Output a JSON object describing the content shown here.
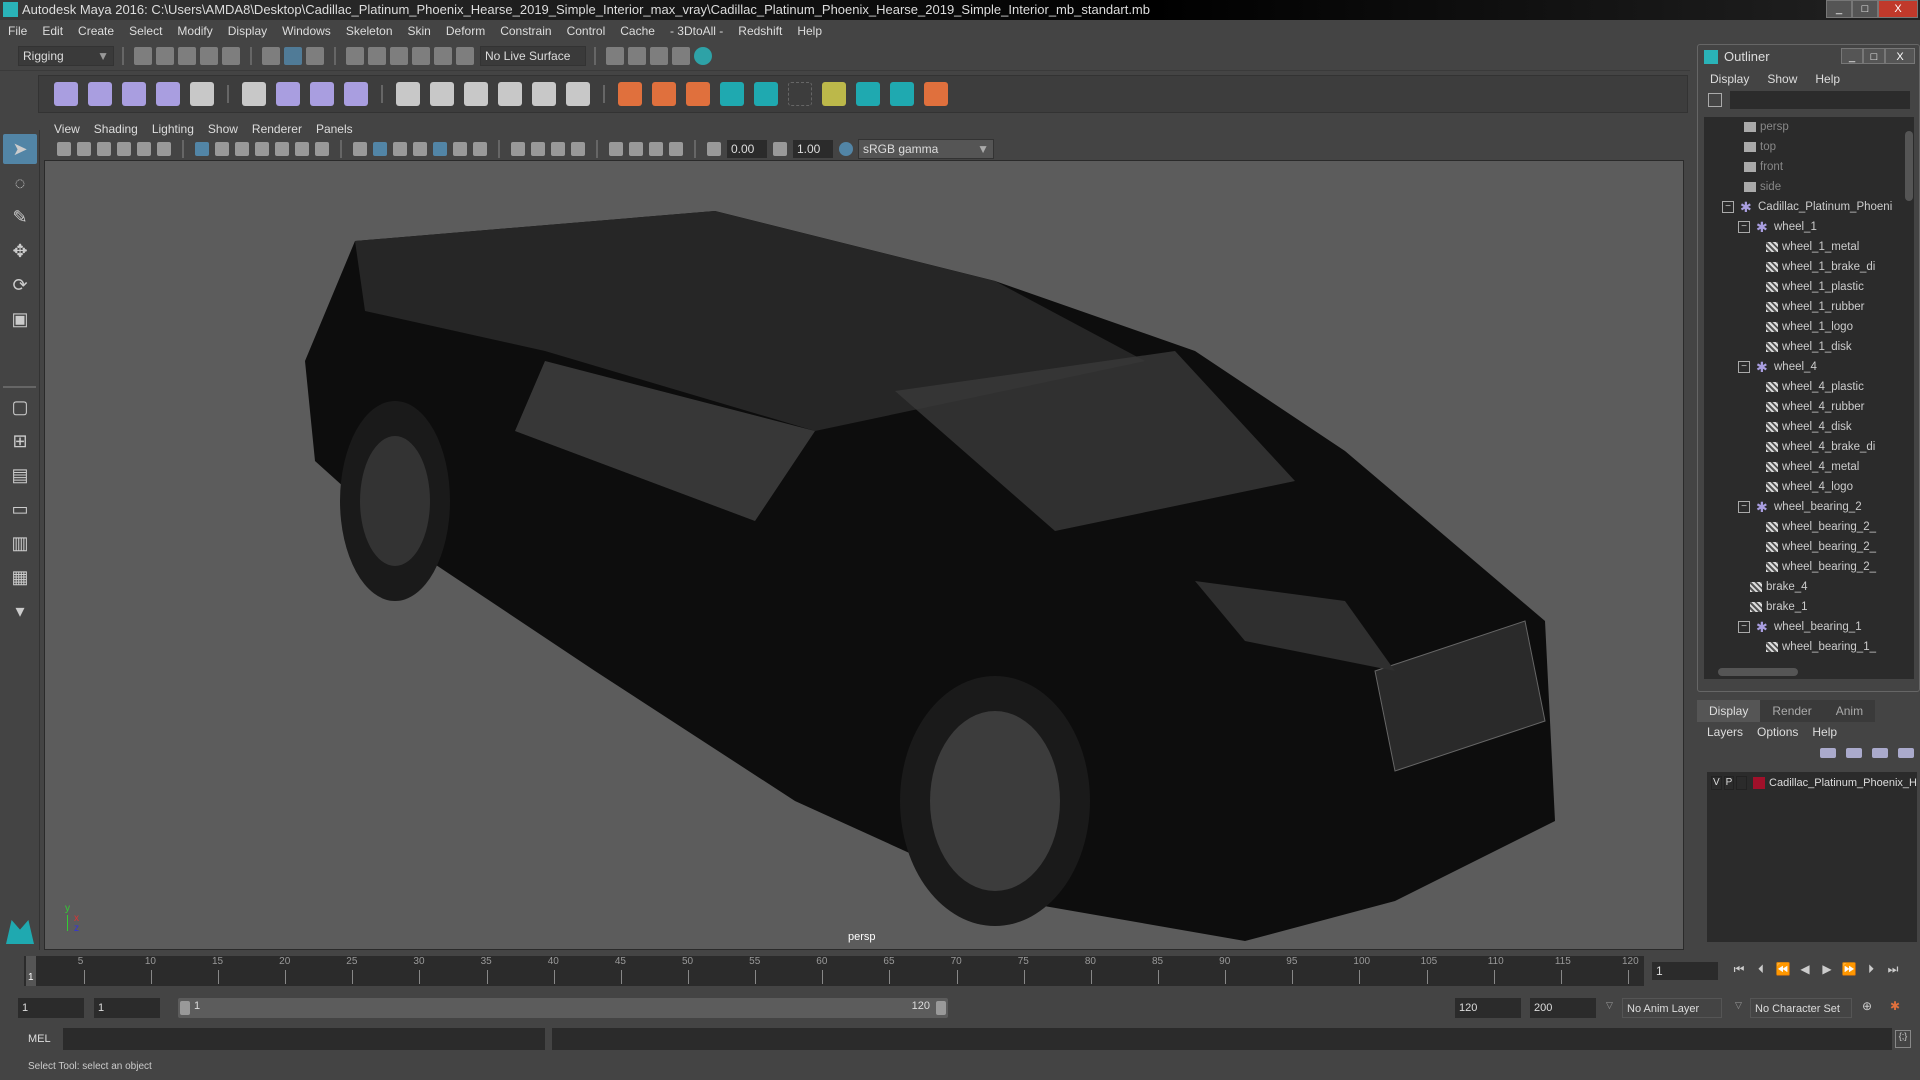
{
  "window": {
    "title": "Autodesk Maya 2016: C:\\Users\\AMDA8\\Desktop\\Cadillac_Platinum_Phoenix_Hearse_2019_Simple_Interior_max_vray\\Cadillac_Platinum_Phoenix_Hearse_2019_Simple_Interior_mb_standart.mb",
    "minimize": "_",
    "maximize": "□",
    "close": "X"
  },
  "menubar": [
    "File",
    "Edit",
    "Create",
    "Select",
    "Modify",
    "Display",
    "Windows",
    "Skeleton",
    "Skin",
    "Deform",
    "Constrain",
    "Control",
    "Cache",
    "- 3DtoAll -",
    "Redshift",
    "Help"
  ],
  "statusline": {
    "mode": "Rigging",
    "live_surface": "No Live Surface"
  },
  "panel": {
    "menu": [
      "View",
      "Shading",
      "Lighting",
      "Show",
      "Renderer",
      "Panels"
    ],
    "exposure": "0.00",
    "gamma": "1.00",
    "color_space": "sRGB gamma",
    "camera_label": "persp",
    "axis": {
      "x": "x",
      "y": "y",
      "z": "z"
    }
  },
  "outliner": {
    "title": "Outliner",
    "menu": [
      "Display",
      "Show",
      "Help"
    ],
    "items": [
      {
        "label": "persp",
        "type": "camera",
        "depth": 0
      },
      {
        "label": "top",
        "type": "camera",
        "depth": 0
      },
      {
        "label": "front",
        "type": "camera",
        "depth": 0
      },
      {
        "label": "side",
        "type": "camera",
        "depth": 0
      },
      {
        "label": "Cadillac_Platinum_Phoeni",
        "type": "group",
        "depth": 0,
        "expanded": true
      },
      {
        "label": "wheel_1",
        "type": "group",
        "depth": 1,
        "expanded": true
      },
      {
        "label": "wheel_1_metal",
        "type": "mesh",
        "depth": 2
      },
      {
        "label": "wheel_1_brake_di",
        "type": "mesh",
        "depth": 2
      },
      {
        "label": "wheel_1_plastic",
        "type": "mesh",
        "depth": 2
      },
      {
        "label": "wheel_1_rubber",
        "type": "mesh",
        "depth": 2
      },
      {
        "label": "wheel_1_logo",
        "type": "mesh",
        "depth": 2
      },
      {
        "label": "wheel_1_disk",
        "type": "mesh",
        "depth": 2
      },
      {
        "label": "wheel_4",
        "type": "group",
        "depth": 1,
        "expanded": true
      },
      {
        "label": "wheel_4_plastic",
        "type": "mesh",
        "depth": 2
      },
      {
        "label": "wheel_4_rubber",
        "type": "mesh",
        "depth": 2
      },
      {
        "label": "wheel_4_disk",
        "type": "mesh",
        "depth": 2
      },
      {
        "label": "wheel_4_brake_di",
        "type": "mesh",
        "depth": 2
      },
      {
        "label": "wheel_4_metal",
        "type": "mesh",
        "depth": 2
      },
      {
        "label": "wheel_4_logo",
        "type": "mesh",
        "depth": 2
      },
      {
        "label": "wheel_bearing_2",
        "type": "group",
        "depth": 1,
        "expanded": true
      },
      {
        "label": "wheel_bearing_2_",
        "type": "mesh",
        "depth": 2
      },
      {
        "label": "wheel_bearing_2_",
        "type": "mesh",
        "depth": 2
      },
      {
        "label": "wheel_bearing_2_",
        "type": "mesh",
        "depth": 2
      },
      {
        "label": "brake_4",
        "type": "mesh",
        "depth": 1
      },
      {
        "label": "brake_1",
        "type": "mesh",
        "depth": 1
      },
      {
        "label": "wheel_bearing_1",
        "type": "group",
        "depth": 1,
        "expanded": true
      },
      {
        "label": "wheel_bearing_1_",
        "type": "mesh",
        "depth": 2
      }
    ]
  },
  "layer_editor": {
    "tabs": [
      "Display",
      "Render",
      "Anim"
    ],
    "active_tab": "Display",
    "menu": [
      "Layers",
      "Options",
      "Help"
    ],
    "layers": [
      {
        "v": "V",
        "p": "P",
        "name": "Cadillac_Platinum_Phoenix_H",
        "color": "#a0102a"
      }
    ]
  },
  "timeline": {
    "ticks": [
      1,
      5,
      10,
      15,
      20,
      25,
      30,
      35,
      40,
      45,
      50,
      55,
      60,
      65,
      70,
      75,
      80,
      85,
      90,
      95,
      100,
      105,
      110,
      115,
      120
    ],
    "current_frame": "1",
    "current_frame_marker": "1"
  },
  "range": {
    "start": "1",
    "playback_start": "1",
    "slider_start": "1",
    "slider_end": "120",
    "playback_end": "120",
    "end": "200",
    "anim_layer": "No Anim Layer",
    "character_set": "No Character Set"
  },
  "mel": {
    "label": "MEL"
  },
  "status": {
    "help": "Select Tool: select an object"
  }
}
